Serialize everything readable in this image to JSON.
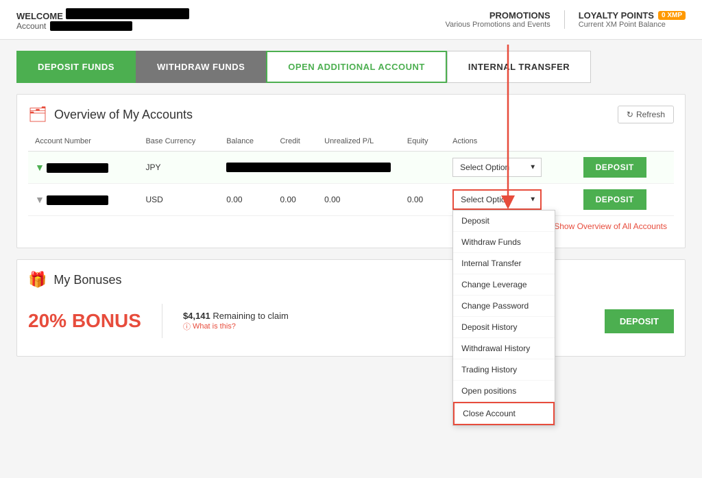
{
  "header": {
    "welcome_label": "WELCOME",
    "account_label": "Account",
    "promotions_title": "PROMOTIONS",
    "promotions_sub": "Various Promotions and Events",
    "loyalty_title": "LOYALTY POINTS",
    "loyalty_badge": "0 XMP",
    "loyalty_sub": "Current XM Point Balance"
  },
  "nav": {
    "tabs": [
      {
        "id": "deposit",
        "label": "DEPOSIT FUNDS",
        "style": "green"
      },
      {
        "id": "withdraw",
        "label": "WITHDRAW FUNDS",
        "style": "gray"
      },
      {
        "id": "open-account",
        "label": "OPEN ADDITIONAL ACCOUNT",
        "style": "outline-green"
      },
      {
        "id": "internal-transfer",
        "label": "INTERNAL TRANSFER",
        "style": "last"
      }
    ]
  },
  "overview": {
    "title": "Overview of My Accounts",
    "refresh_label": "Refresh",
    "table": {
      "headers": [
        "Account Number",
        "Base Currency",
        "Balance",
        "Credit",
        "Unrealized P/L",
        "Equity",
        "Actions"
      ],
      "rows": [
        {
          "id": "row1",
          "currency": "JPY",
          "balance_redacted": true,
          "credit": "",
          "unrealized": "",
          "equity": "",
          "select_label": "Select Option",
          "active": false
        },
        {
          "id": "row2",
          "currency": "USD",
          "balance_redacted": false,
          "credit": "0.00",
          "unrealized": "0.00",
          "equity": "0.00",
          "balance": "0.00",
          "select_label": "Select Option",
          "active": true
        }
      ]
    },
    "show_all": "Show Overview of All Accounts"
  },
  "dropdown_menu": {
    "items": [
      {
        "id": "deposit",
        "label": "Deposit",
        "highlighted": false
      },
      {
        "id": "withdraw-funds",
        "label": "Withdraw Funds",
        "highlighted": false
      },
      {
        "id": "internal-transfer",
        "label": "Internal Transfer",
        "highlighted": false
      },
      {
        "id": "change-leverage",
        "label": "Change Leverage",
        "highlighted": false
      },
      {
        "id": "change-password",
        "label": "Change Password",
        "highlighted": false
      },
      {
        "id": "deposit-history",
        "label": "Deposit History",
        "highlighted": false
      },
      {
        "id": "withdrawal-history",
        "label": "Withdrawal History",
        "highlighted": false
      },
      {
        "id": "trading-history",
        "label": "Trading History",
        "highlighted": false
      },
      {
        "id": "open-positions",
        "label": "Open positions",
        "highlighted": false
      },
      {
        "id": "close-account",
        "label": "Close Account",
        "highlighted": true
      }
    ]
  },
  "bonuses": {
    "title": "My Bonuses",
    "bonus_percent": "20% BONUS",
    "remaining_amount": "$4,141",
    "remaining_label": "Remaining to claim",
    "what_label": "What is this?",
    "deposit_label": "DEPOSIT"
  }
}
